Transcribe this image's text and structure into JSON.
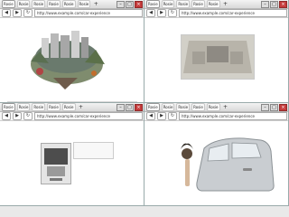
{
  "windows": [
    {
      "position": "top-left",
      "tabs": [
        "Rosie",
        "Rosie",
        "Rosie",
        "Rosie",
        "Rosie",
        "Rosie",
        "Rosie",
        "Rosie",
        "Rosie",
        "Rosie",
        "Rosie",
        "Rosie"
      ],
      "url": "http://www.example.com/car-experience",
      "content_caption": ""
    },
    {
      "position": "top-right",
      "tabs": [
        "Rosie",
        "Rosie",
        "Rosie",
        "Rosie",
        "Rosie",
        "Rosie"
      ],
      "url": "http://www.example.com/car-experience",
      "content_caption": ""
    },
    {
      "position": "bottom-left",
      "tabs": [
        "Rosie",
        "Rosie",
        "Rosie",
        "Rosie",
        "Rosie",
        "Rosie"
      ],
      "url": "http://www.example.com/car-experience",
      "content_caption": ""
    },
    {
      "position": "bottom-right",
      "tabs": [
        "Rosie",
        "Rosie",
        "Rosie",
        "Rosie",
        "Rosie",
        "Rosie"
      ],
      "url": "http://www.example.com/car-experience",
      "content_caption": ""
    }
  ],
  "controls": {
    "back": "◀",
    "forward": "▶",
    "reload": "↻",
    "new_tab": "+",
    "min": "–",
    "max": "□",
    "close": "×"
  }
}
